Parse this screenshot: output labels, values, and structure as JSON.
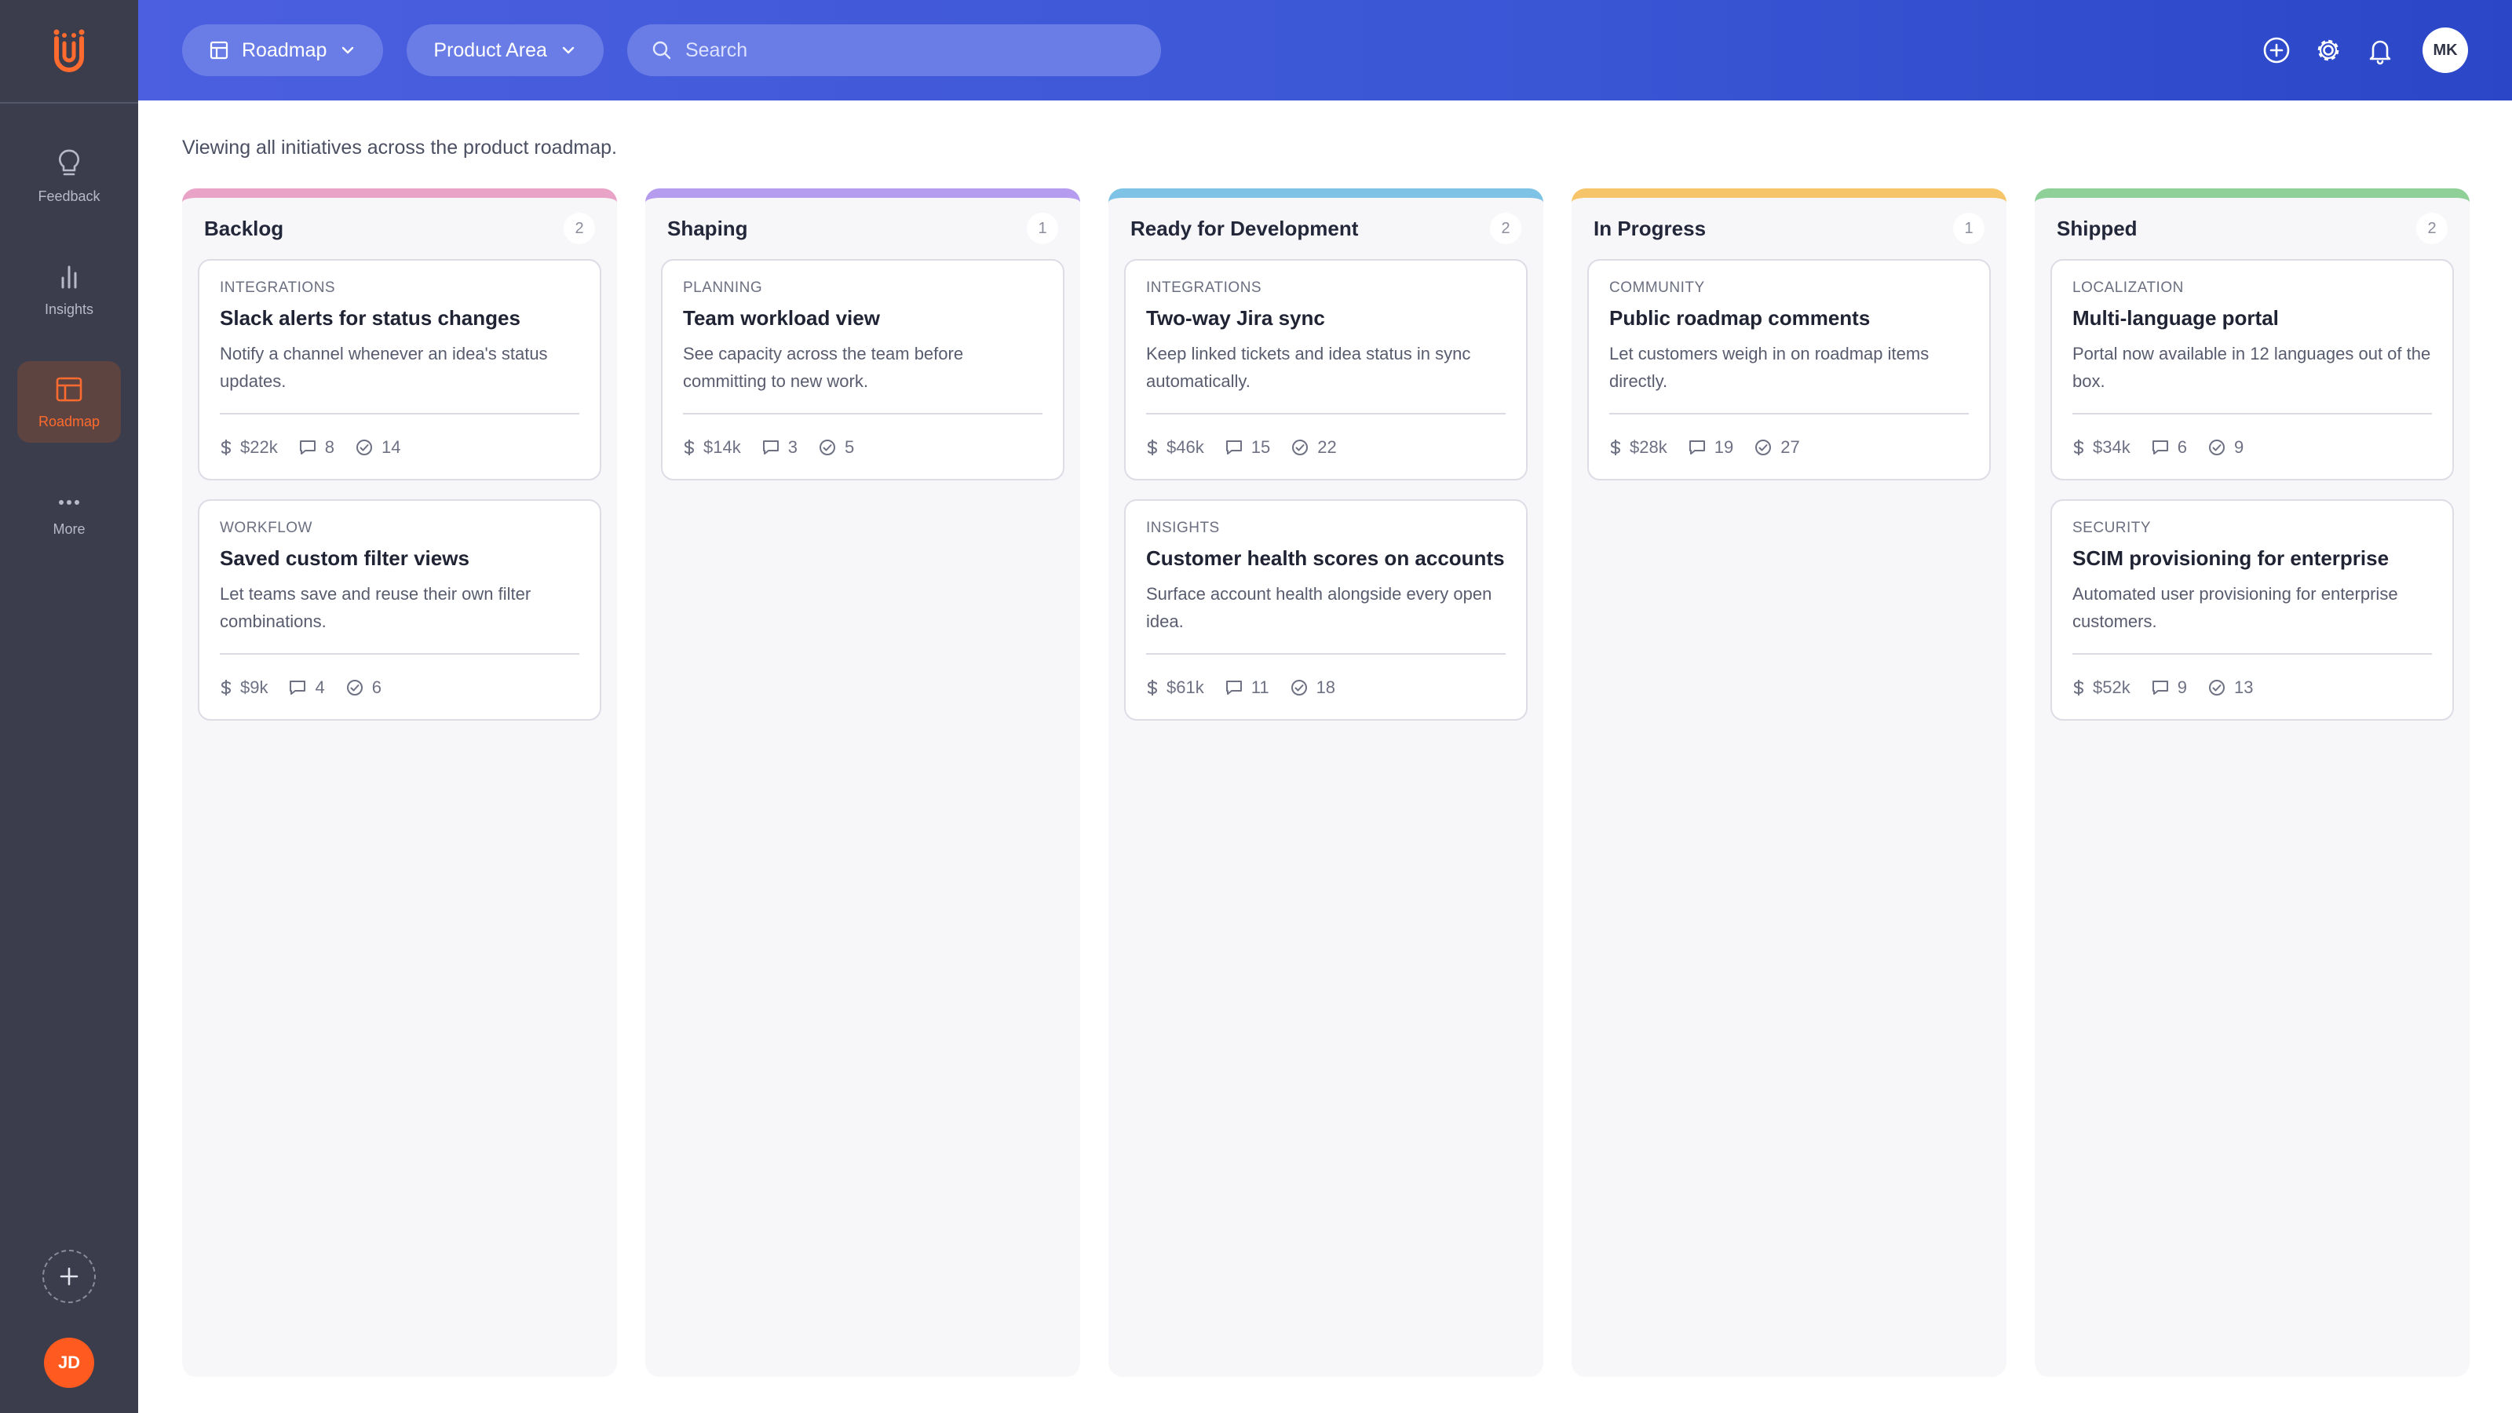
{
  "sidebar": {
    "items": [
      {
        "label": "Feedback",
        "icon": "lightbulb-icon"
      },
      {
        "label": "Insights",
        "icon": "bar-chart-icon"
      },
      {
        "label": "Roadmap",
        "icon": "roadmap-icon",
        "active": true
      },
      {
        "label": "More",
        "icon": "more-dots-icon"
      }
    ],
    "user_initials": "JD",
    "accent": "#ff6a2e"
  },
  "topbar": {
    "view_label": "Roadmap",
    "filter_label": "Product Area",
    "search_placeholder": "Search",
    "user_initials": "MK"
  },
  "main": {
    "subtitle": "Viewing all initiatives across the product roadmap."
  },
  "columns": [
    {
      "title": "Backlog",
      "count": "2",
      "color": "#e9a3c7",
      "cards": [
        {
          "category": "Integrations",
          "title": "Slack alerts for status changes",
          "desc": "Notify a channel whenever an idea's status updates.",
          "value": "$22k",
          "comments": "8",
          "votes": "14"
        },
        {
          "category": "Workflow",
          "title": "Saved custom filter views",
          "desc": "Let teams save and reuse their own filter combinations.",
          "value": "$9k",
          "comments": "4",
          "votes": "6"
        }
      ]
    },
    {
      "title": "Shaping",
      "count": "1",
      "color": "#b59cef",
      "cards": [
        {
          "category": "Planning",
          "title": "Team workload view",
          "desc": "See capacity across the team before committing to new work.",
          "value": "$14k",
          "comments": "3",
          "votes": "5"
        }
      ]
    },
    {
      "title": "Ready for Development",
      "count": "2",
      "color": "#7ec3e6",
      "cards": [
        {
          "category": "Integrations",
          "title": "Two-way Jira sync",
          "desc": "Keep linked tickets and idea status in sync automatically.",
          "value": "$46k",
          "comments": "15",
          "votes": "22"
        },
        {
          "category": "Insights",
          "title": "Customer health scores on accounts",
          "desc": "Surface account health alongside every open idea.",
          "value": "$61k",
          "comments": "11",
          "votes": "18"
        }
      ]
    },
    {
      "title": "In Progress",
      "count": "1",
      "color": "#f6c56a",
      "cards": [
        {
          "category": "Community",
          "title": "Public roadmap comments",
          "desc": "Let customers weigh in on roadmap items directly.",
          "value": "$28k",
          "comments": "19",
          "votes": "27"
        }
      ]
    },
    {
      "title": "Shipped",
      "count": "2",
      "color": "#8fcf98",
      "cards": [
        {
          "category": "Localization",
          "title": "Multi-language portal",
          "desc": "Portal now available in 12 languages out of the box.",
          "value": "$34k",
          "comments": "6",
          "votes": "9"
        },
        {
          "category": "Security",
          "title": "SCIM provisioning for enterprise",
          "desc": "Automated user provisioning for enterprise customers.",
          "value": "$52k",
          "comments": "9",
          "votes": "13"
        }
      ]
    }
  ]
}
